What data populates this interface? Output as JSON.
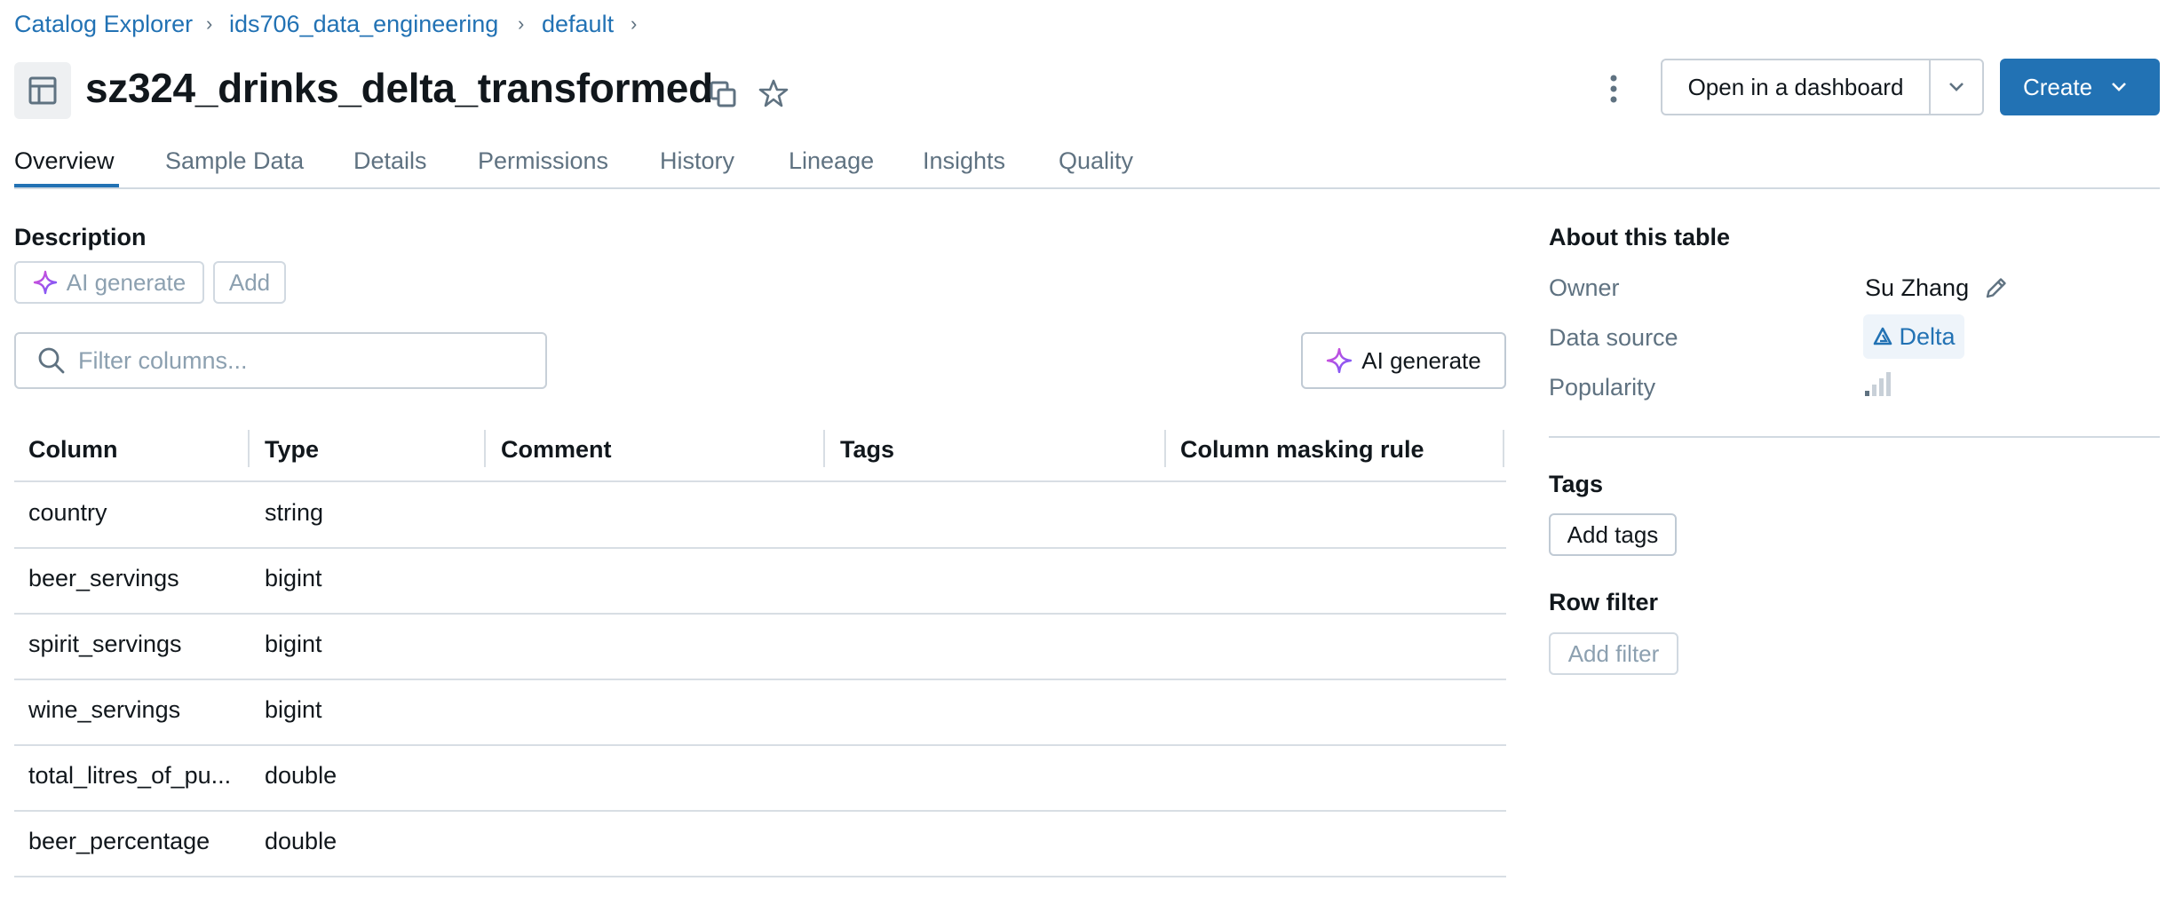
{
  "breadcrumb": [
    "Catalog Explorer",
    "ids706_data_engineering",
    "default"
  ],
  "header": {
    "title": "sz324_drinks_delta_transformed",
    "open_dashboard_label": "Open in a dashboard",
    "create_label": "Create"
  },
  "tabs": [
    "Overview",
    "Sample Data",
    "Details",
    "Permissions",
    "History",
    "Lineage",
    "Insights",
    "Quality"
  ],
  "active_tab": "Overview",
  "description": {
    "label": "Description",
    "ai_generate_label": "AI generate",
    "add_label": "Add"
  },
  "filter": {
    "placeholder": "Filter columns...",
    "ai_generate_label": "AI generate"
  },
  "columns_table": {
    "headers": [
      "Column",
      "Type",
      "Comment",
      "Tags",
      "Column masking rule"
    ],
    "rows": [
      {
        "column": "country",
        "type": "string"
      },
      {
        "column": "beer_servings",
        "type": "bigint"
      },
      {
        "column": "spirit_servings",
        "type": "bigint"
      },
      {
        "column": "wine_servings",
        "type": "bigint"
      },
      {
        "column": "total_litres_of_pu...",
        "type": "double"
      },
      {
        "column": "beer_percentage",
        "type": "double"
      }
    ]
  },
  "about": {
    "title": "About this table",
    "owner_label": "Owner",
    "owner_value": "Su Zhang",
    "data_source_label": "Data source",
    "data_source_value": "Delta",
    "popularity_label": "Popularity",
    "popularity_level": 1,
    "popularity_max": 4
  },
  "tags_section": {
    "title": "Tags",
    "add_tags_label": "Add tags"
  },
  "row_filter": {
    "title": "Row filter",
    "add_filter_label": "Add filter"
  },
  "colors": {
    "accent": "#2272b4",
    "text": "#11171c",
    "muted": "#5f7281",
    "border": "#d1d9e1",
    "sparkle_start": "#e14ad2",
    "sparkle_end": "#6a5cff"
  },
  "icons": {
    "table": "table-icon",
    "copy": "copy-icon",
    "favorite": "star-icon",
    "more": "kebab-menu-icon",
    "dropdown": "chevron-down-icon",
    "search": "search-icon",
    "sparkle": "sparkle-icon",
    "edit": "pencil-icon",
    "delta": "delta-logo-icon",
    "popularity": "signal-bars-icon"
  }
}
